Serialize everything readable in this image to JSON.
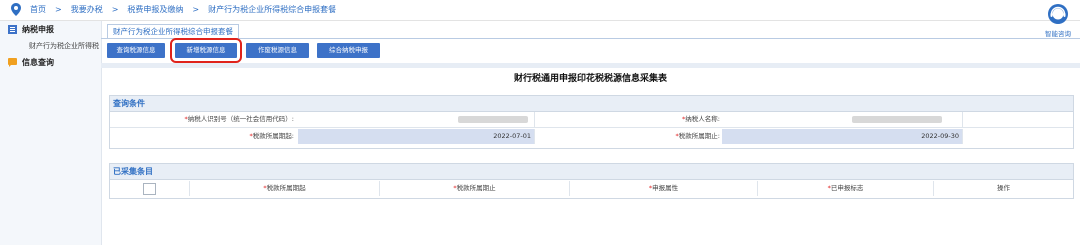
{
  "breadcrumb": {
    "items": [
      "首页",
      "我要办税",
      "税费申报及缴纳",
      "财产行为税企业所得税综合申报套餐"
    ],
    "separator": ">"
  },
  "sidebar": {
    "groups": [
      {
        "label": "纳税申报",
        "icon": "list-icon"
      },
      {
        "label": "信息查询",
        "icon": "chat-icon"
      }
    ],
    "sub_item": "财产行为税企业所得税"
  },
  "tab": {
    "label": "财产行为税企业所得税综合申报套餐"
  },
  "help": {
    "label": "智能咨询",
    "icon": "customer-service-icon"
  },
  "toolbar": {
    "buttons": [
      "查询税源信息",
      "新增税源信息",
      "作废税源信息",
      "综合纳税申报"
    ],
    "selected_index": 1
  },
  "form": {
    "title": "财行税通用申报印花税税源信息采集表",
    "query_section": {
      "title": "查询条件",
      "taxpayer_id_label": "纳税人识别号（统一社会信用代码）:",
      "taxpayer_name_label": "纳税人名称:",
      "period_start_label": "税款所属期起:",
      "period_start_value": "2022-07-01",
      "period_end_label": "税款所属期止:",
      "period_end_value": "2022-09-30",
      "required_mark": "*"
    },
    "collected_section": {
      "title": "已采集条目",
      "columns": [
        "税款所属期起",
        "税款所属期止",
        "申报属性",
        "已申报标志",
        "操作"
      ]
    }
  },
  "colors": {
    "accent": "#3d72c8",
    "highlight": "#e0231b",
    "link": "#2f6fc3"
  }
}
